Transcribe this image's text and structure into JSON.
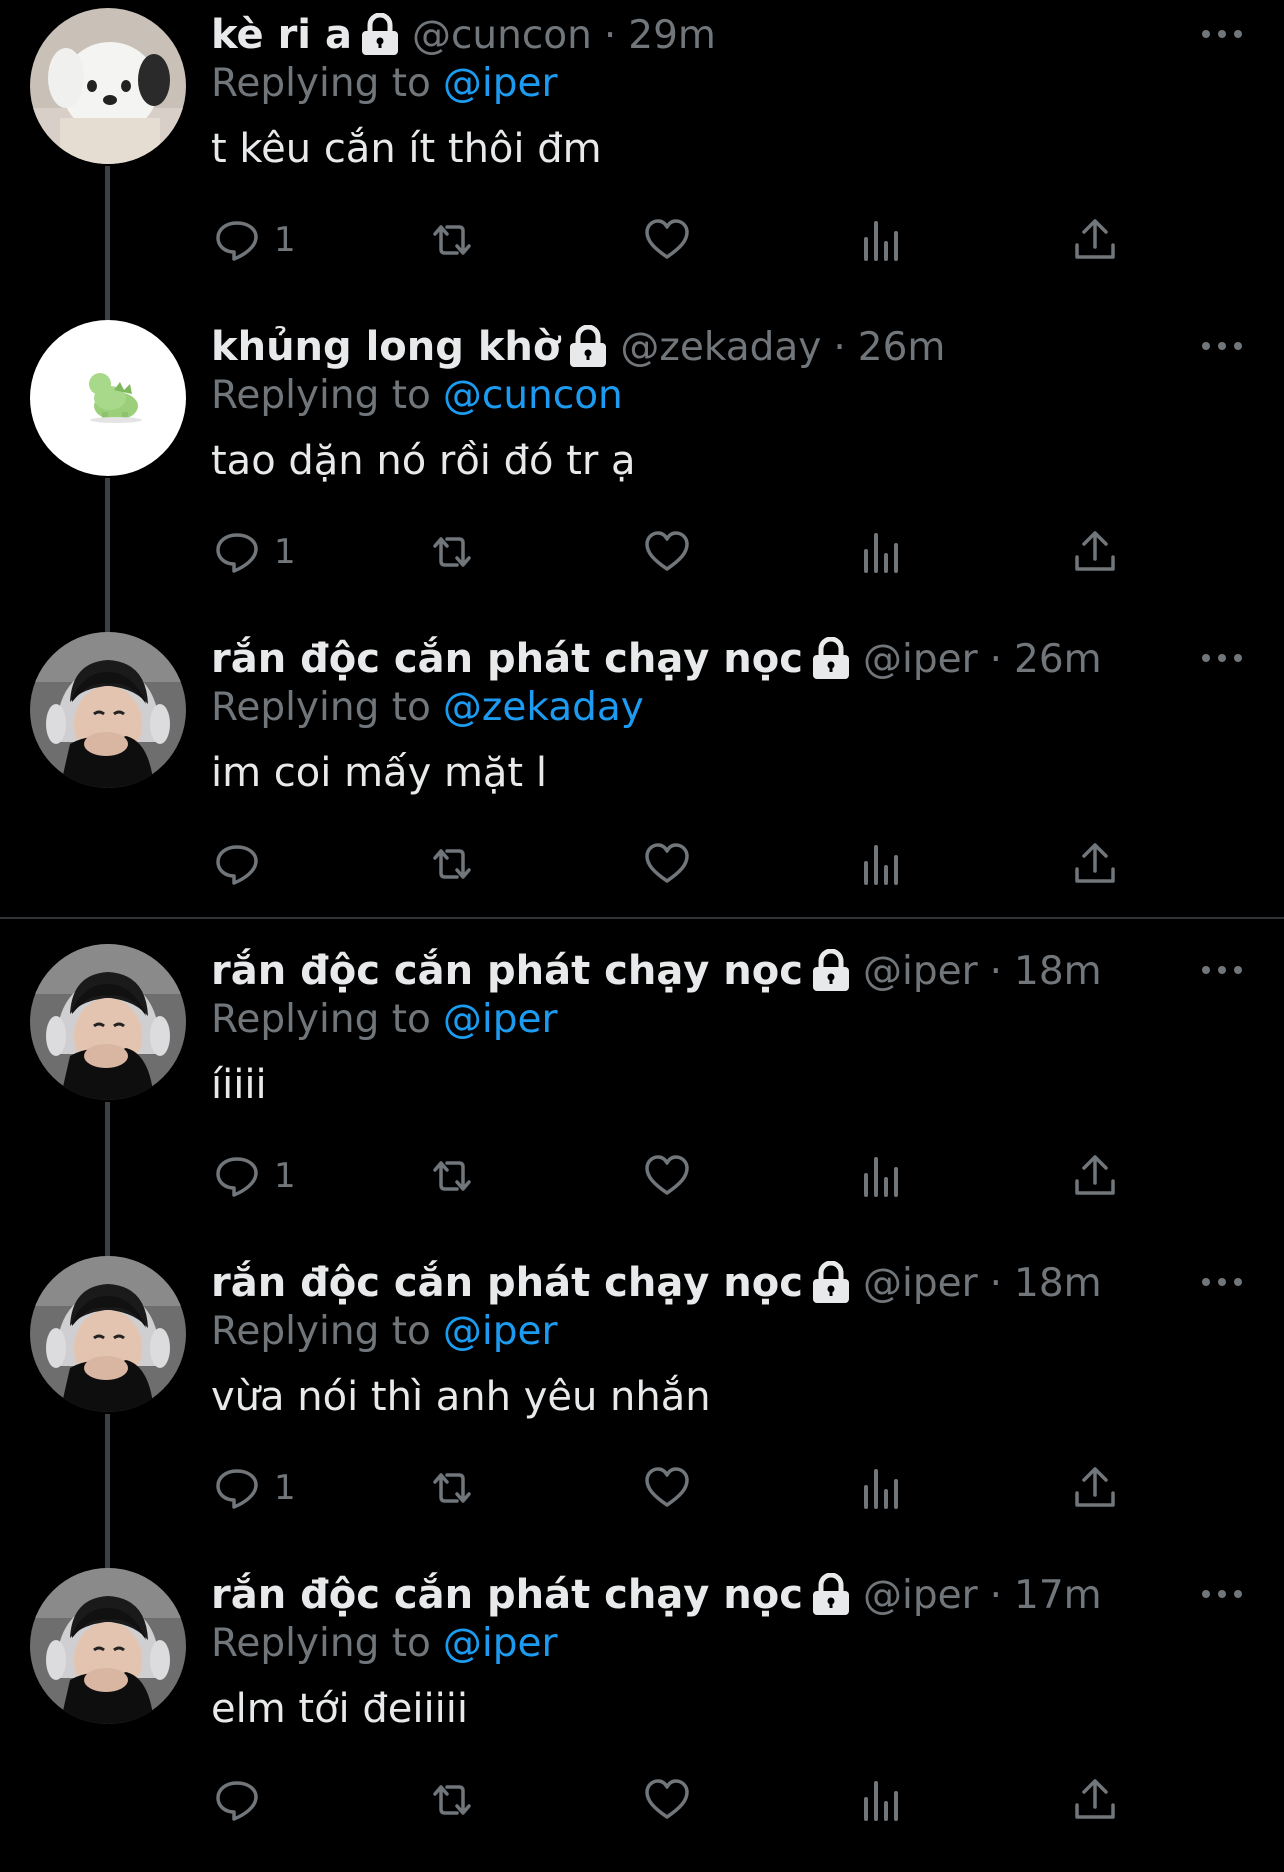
{
  "tweets": [
    {
      "name": "kè ri a",
      "handle": "@cuncon",
      "separator": "·",
      "time": "29m",
      "replying_label": "Replying to",
      "replying_to": "@iper",
      "text": "t kêu cắn ít thôi đm",
      "reply_count": "1",
      "avatar": "white-plush-dog"
    },
    {
      "name": "khủng long khờ",
      "handle": "@zekaday",
      "separator": "·",
      "time": "26m",
      "replying_label": "Replying to",
      "replying_to": "@cuncon",
      "text": "tao dặn nó rồi đó tr ạ",
      "reply_count": "1",
      "avatar": "green-dinosaur"
    },
    {
      "name": "rắn độc cắn phát chạy nọc",
      "handle": "@iper",
      "separator": "·",
      "time": "26m",
      "replying_label": "Replying to",
      "replying_to": "@zekaday",
      "text": "im coi mấy mặt l",
      "reply_count": "",
      "avatar": "boy-with-headphones"
    },
    {
      "name": "rắn độc cắn phát chạy nọc",
      "handle": "@iper",
      "separator": "·",
      "time": "18m",
      "replying_label": "Replying to",
      "replying_to": "@iper",
      "text": "íiiii",
      "reply_count": "1",
      "avatar": "boy-with-headphones"
    },
    {
      "name": "rắn độc cắn phát chạy nọc",
      "handle": "@iper",
      "separator": "·",
      "time": "18m",
      "replying_label": "Replying to",
      "replying_to": "@iper",
      "text": "vừa nói thì anh yêu nhắn",
      "reply_count": "1",
      "avatar": "boy-with-headphones"
    },
    {
      "name": "rắn độc cắn phát chạy nọc",
      "handle": "@iper",
      "separator": "·",
      "time": "17m",
      "replying_label": "Replying to",
      "replying_to": "@iper",
      "text": "elm tới đeiiiii",
      "reply_count": "",
      "avatar": "boy-with-headphones"
    }
  ],
  "colors": {
    "background": "#000000",
    "primary_text": "#e7e9ea",
    "secondary_text": "#71767b",
    "link": "#1d9bf0",
    "thread_line": "#3d4043",
    "separator": "#2f3336"
  },
  "icons": {
    "lock": "lock-icon",
    "more": "more-icon",
    "reply": "reply-icon",
    "retweet": "retweet-icon",
    "like": "heart-icon",
    "views": "analytics-icon",
    "share": "share-icon"
  }
}
